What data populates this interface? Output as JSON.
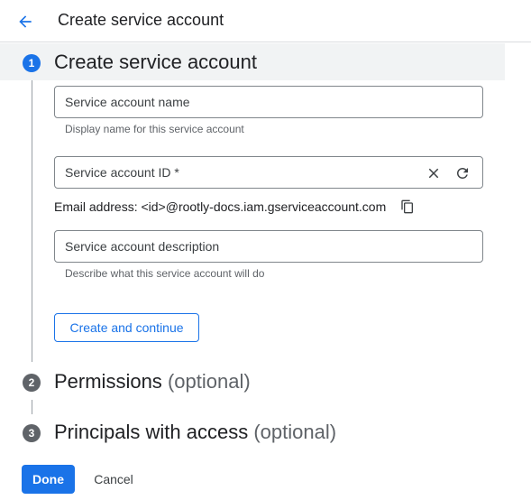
{
  "header": {
    "title": "Create service account",
    "back_icon": "arrow-back-icon"
  },
  "steps": [
    {
      "number": "1",
      "title": "Create service account",
      "optional": "",
      "state": "active"
    },
    {
      "number": "2",
      "title": "Permissions",
      "optional": "(optional)",
      "state": "inactive"
    },
    {
      "number": "3",
      "title": "Principals with access",
      "optional": "(optional)",
      "state": "inactive"
    }
  ],
  "form": {
    "name": {
      "value": "",
      "placeholder": "Service account name",
      "hint": "Display name for this service account"
    },
    "id": {
      "value": "",
      "placeholder": "Service account ID *",
      "clear_icon": "close-icon",
      "refresh_icon": "refresh-icon"
    },
    "email": {
      "text": "Email address: <id>@rootly-docs.iam.gserviceaccount.com",
      "copy_icon": "copy-icon"
    },
    "description": {
      "value": "",
      "placeholder": "Service account description",
      "hint": "Describe what this service account will do"
    },
    "create_button": "Create and continue"
  },
  "footer": {
    "done_label": "Done",
    "cancel_label": "Cancel"
  },
  "colors": {
    "accent": "#1a73e8",
    "inactive_step": "#5f6368",
    "divider": "#dadce0"
  }
}
